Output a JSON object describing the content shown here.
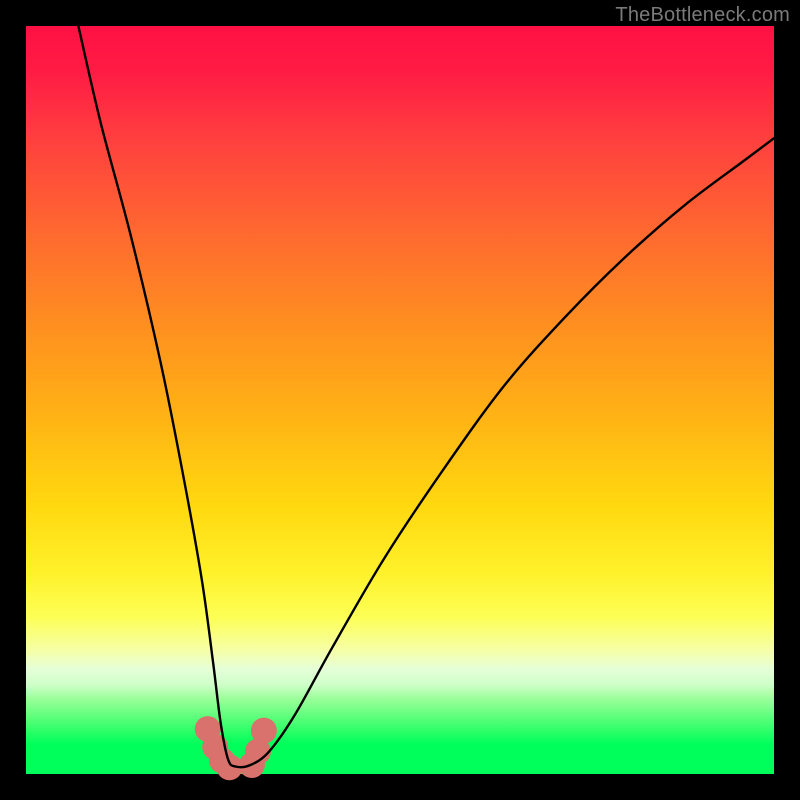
{
  "watermark": "TheBottleneck.com",
  "chart_data": {
    "type": "line",
    "title": "",
    "xlabel": "",
    "ylabel": "",
    "xlim": [
      0,
      100
    ],
    "ylim": [
      0,
      100
    ],
    "series": [
      {
        "name": "bottleneck-curve",
        "x": [
          7,
          10,
          14,
          18,
          21,
          23.5,
          25,
          26,
          27,
          28,
          30,
          32.5,
          36,
          41,
          48,
          56,
          64,
          72,
          80,
          88,
          96,
          100
        ],
        "values": [
          100,
          87,
          72,
          55,
          40,
          26,
          15,
          7,
          2,
          1,
          1.2,
          3,
          8,
          17,
          29,
          41,
          52,
          61,
          69,
          76,
          82,
          85
        ]
      }
    ],
    "markers": {
      "name": "highlight-markers",
      "x": [
        24.3,
        25.3,
        26.2,
        27.2,
        30.2,
        31.0,
        31.8
      ],
      "values": [
        6.0,
        3.6,
        1.8,
        0.9,
        1.2,
        3.0,
        5.8
      ],
      "color": "#d9716c",
      "radius_px": 13
    },
    "background_gradient": {
      "top": "#ff1143",
      "mid": "#ffd80f",
      "bottom": "#00ff5a"
    }
  }
}
